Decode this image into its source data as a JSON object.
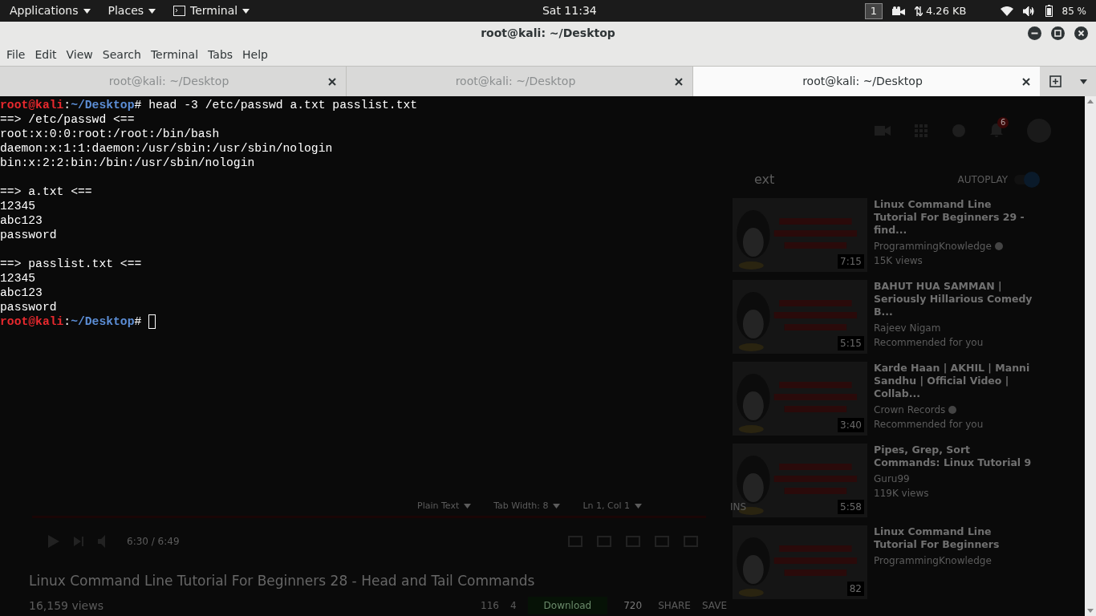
{
  "top_panel": {
    "menus": [
      "Applications",
      "Places",
      "Terminal"
    ],
    "clock": "Sat 11:34",
    "workspace": "1",
    "network": "4.26 KB",
    "battery": "85 %"
  },
  "window": {
    "title": "root@kali: ~/Desktop",
    "menu": [
      "File",
      "Edit",
      "View",
      "Search",
      "Terminal",
      "Tabs",
      "Help"
    ],
    "tabs": [
      {
        "label": "root@kali: ~/Desktop",
        "selected": false
      },
      {
        "label": "root@kali: ~/Desktop",
        "selected": false
      },
      {
        "label": "root@kali: ~/Desktop",
        "selected": true
      }
    ],
    "terminal": [
      {
        "kind": "prompt",
        "user": "root@kali",
        "sep": ":",
        "path": "~/Desktop",
        "symbol": "#",
        "command": "head -3 /etc/passwd a.txt passlist.txt",
        "cursor": false
      },
      {
        "kind": "output",
        "text": "==> /etc/passwd <=="
      },
      {
        "kind": "output",
        "text": "root:x:0:0:root:/root:/bin/bash"
      },
      {
        "kind": "output",
        "text": "daemon:x:1:1:daemon:/usr/sbin:/usr/sbin/nologin"
      },
      {
        "kind": "output",
        "text": "bin:x:2:2:bin:/bin:/usr/sbin/nologin"
      },
      {
        "kind": "blank"
      },
      {
        "kind": "output",
        "text": "==> a.txt <=="
      },
      {
        "kind": "output",
        "text": "12345"
      },
      {
        "kind": "output",
        "text": "abc123"
      },
      {
        "kind": "output",
        "text": "password"
      },
      {
        "kind": "blank"
      },
      {
        "kind": "output",
        "text": "==> passlist.txt <=="
      },
      {
        "kind": "output",
        "text": "12345"
      },
      {
        "kind": "output",
        "text": "abc123"
      },
      {
        "kind": "output",
        "text": "password"
      },
      {
        "kind": "prompt",
        "user": "root@kali",
        "sep": ":",
        "path": "~/Desktop",
        "symbol": "#",
        "cursor": true
      }
    ]
  },
  "background_page": {
    "notification_count": "6",
    "up_next": "ext",
    "autoplay": {
      "label": "AUTOPLAY",
      "on": true
    },
    "recommendations": [
      {
        "title": "Linux Command Line Tutorial For Beginners 29 - find...",
        "channel": "ProgrammingKnowledge",
        "verified": true,
        "meta": "15K views",
        "duration": "7:15"
      },
      {
        "title": "BAHUT HUA SAMMAN | Seriously Hillarious Comedy B...",
        "channel": "Rajeev Nigam",
        "verified": false,
        "meta": "Recommended for you",
        "duration": "5:15"
      },
      {
        "title": "Karde Haan | AKHIL | Manni Sandhu | Official Video | Collab...",
        "channel": "Crown Records",
        "verified": true,
        "meta": "Recommended for you",
        "duration": "3:40"
      },
      {
        "title": "Pipes, Grep, Sort Commands: Linux Tutorial 9",
        "channel": "Guru99",
        "verified": false,
        "meta": "119K views",
        "duration": "5:58"
      },
      {
        "title": "Linux Command Line Tutorial For Beginners",
        "channel": "ProgrammingKnowledge",
        "verified": false,
        "duration": "82"
      }
    ],
    "editor_status": [
      "Plain Text",
      "Tab Width: 8",
      "Ln 1, Col 1"
    ],
    "editor_mode": "INS",
    "player": {
      "time": "6:30 / 6:49",
      "title": "Linux Command Line Tutorial For Beginners 28 - Head and Tail Commands",
      "views": "16,159 views",
      "likes": "116",
      "dislikes": "4",
      "download": "Download",
      "quality": "720",
      "share": "SHARE",
      "save": "SAVE"
    }
  }
}
